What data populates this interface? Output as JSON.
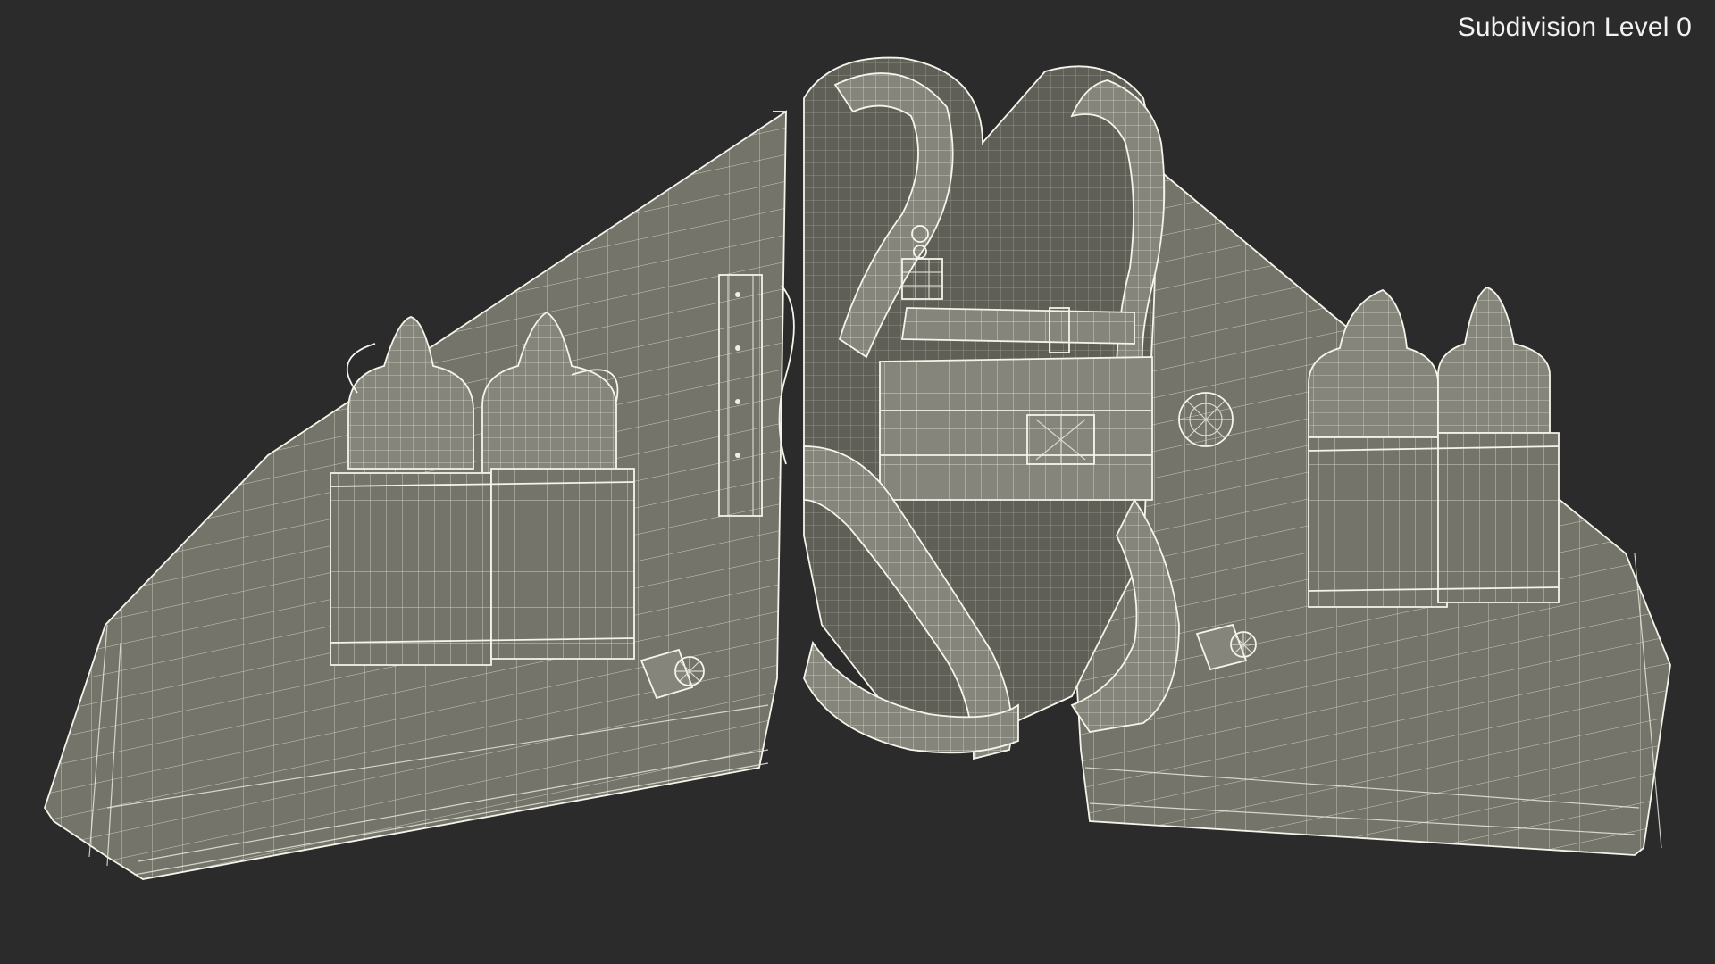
{
  "viewport": {
    "overlay_label": "Subdivision Level 0",
    "background_color": "#2b2b2b",
    "mesh_color": "#74746a",
    "wire_color": "#e8e8dc"
  },
  "model": {
    "subject": "jetpack-wingsuit-wireframe-icon"
  }
}
